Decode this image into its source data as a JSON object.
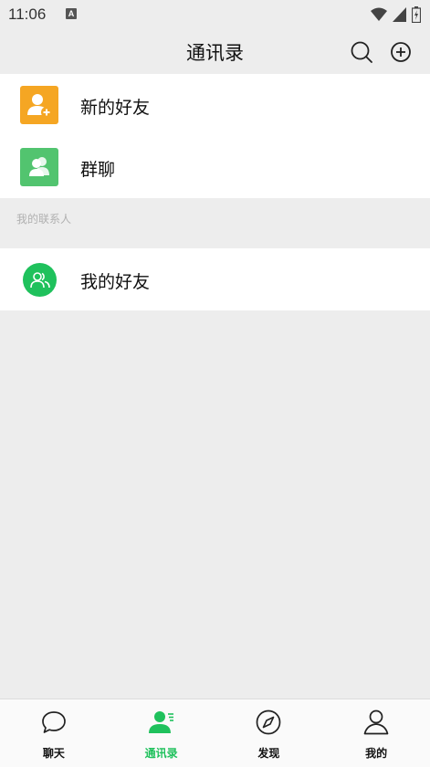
{
  "status_bar": {
    "time": "11:06",
    "notification_letter": "A"
  },
  "header": {
    "title": "通讯录"
  },
  "contacts": {
    "items": [
      {
        "label": "新的好友",
        "icon": "add-friend-icon",
        "color": "#f5a623"
      },
      {
        "label": "群聊",
        "icon": "group-chat-icon",
        "color": "#52c46f"
      }
    ],
    "section_title": "我的联系人",
    "friends_label": "我的好友",
    "friends_color": "#1fc15c"
  },
  "tabbar": {
    "tabs": [
      {
        "label": "聊天",
        "icon": "chat-bubble-icon",
        "active": false
      },
      {
        "label": "通讯录",
        "icon": "contacts-icon",
        "active": true
      },
      {
        "label": "发现",
        "icon": "compass-icon",
        "active": false
      },
      {
        "label": "我的",
        "icon": "profile-icon",
        "active": false
      }
    ],
    "active_color": "#1fc15c"
  }
}
